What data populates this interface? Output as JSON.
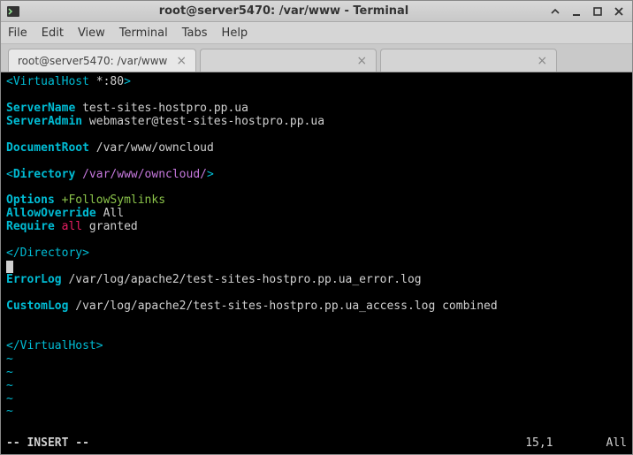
{
  "titlebar": {
    "title": "root@server5470: /var/www - Terminal"
  },
  "menu": {
    "file": "File",
    "edit": "Edit",
    "view": "View",
    "terminal": "Terminal",
    "tabs": "Tabs",
    "help": "Help"
  },
  "tabs": {
    "t0": {
      "label": "root@server5470: /var/www"
    },
    "t1": {
      "label": " "
    },
    "t2": {
      "label": " "
    }
  },
  "config": {
    "vh_open": "<VirtualHost",
    "vh_star": " *:80",
    "vh_close": ">",
    "servername_k": "ServerName",
    "servername_v": " test-sites-hostpro.pp.ua",
    "serveradmin_k": "ServerAdmin",
    "serveradmin_v": " webmaster@test-sites-hostpro.pp.ua",
    "docroot_k": "DocumentRoot",
    "docroot_v": " /var/www/owncloud",
    "dir_open_lt": "<",
    "dir_open_kw": "Directory",
    "dir_open_path": " /var/www/owncloud/",
    "dir_open_gt": ">",
    "options_k": "Options",
    "options_v": " +FollowSymlinks",
    "allowoverride_k": "AllowOverride",
    "allowoverride_v": " All",
    "require_k": "Require",
    "require_v1": " all",
    "require_v2": " granted",
    "dir_close": "</Directory>",
    "errorlog_k": "ErrorLog",
    "errorlog_v": " /var/log/apache2/test-sites-hostpro.pp.ua_error.log",
    "customlog_k": "CustomLog",
    "customlog_v": " /var/log/apache2/test-sites-hostpro.pp.ua_access.log combined",
    "vh_end": "</VirtualHost>"
  },
  "vim": {
    "tilde": "~",
    "mode": "-- INSERT --",
    "pos": "15,1",
    "scroll": "All"
  }
}
